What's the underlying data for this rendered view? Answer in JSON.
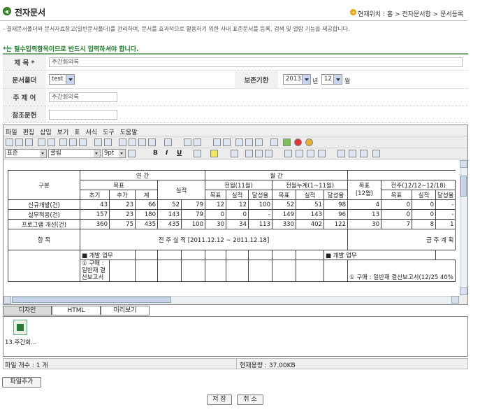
{
  "header": {
    "title": "전자문서",
    "location": "현재위치 : 홈 > 전자문서함 > 문서등록"
  },
  "description": "- 결재문서폴더와 문서자료창고(일반문서폴더)를 관리하며, 문서를 효과적으로 활용하기 위한 사내 표준문서를 등록, 검색 및 열람 기능을 제공합니다.",
  "required_note": "*는 필수입력항목이므로 반드시 입력하셔야 합니다.",
  "form": {
    "title_label": "제 목 *",
    "title_value": "주간회의록",
    "folder_label": "문서폴더",
    "folder_value": "test",
    "retention_label": "보존기한",
    "year_value": "2013",
    "year_unit": "년",
    "month_value": "12",
    "month_unit": "월",
    "subject_label": "주 제 어",
    "subject_value": "주간회의록",
    "ref_label": "참조문헌",
    "ref_value": ""
  },
  "editor": {
    "menu": [
      "파일",
      "편집",
      "삽입",
      "보기",
      "표",
      "서식",
      "도구",
      "도움말"
    ],
    "style_value": "표준",
    "font_value": "굴림",
    "size_value": "9pt",
    "tabs": [
      "디자인",
      "HTML",
      "미리보기"
    ],
    "table": {
      "h_gubun": "구분",
      "h_yearly": "연 간",
      "h_monthly": "월 간",
      "h_target": "목표",
      "h_actual": "실적",
      "h_initial": "초기",
      "h_added": "추가",
      "h_total": "계",
      "h_rate": "달성율",
      "h_prev_month": "전월(11월)",
      "h_cumulative": "전월누계(1~11월)",
      "h_target12": "목표\n(12월)",
      "h_prev_week": "전주(12/12~12/18)",
      "rows": [
        {
          "name": "신규개발(건)",
          "v": [
            "43",
            "23",
            "66",
            "52",
            "79",
            "12",
            "12",
            "100",
            "52",
            "51",
            "98",
            "4",
            "0",
            "0",
            "-"
          ]
        },
        {
          "name": "실무적용(건)",
          "v": [
            "157",
            "23",
            "180",
            "143",
            "79",
            "0",
            "0",
            "-",
            "149",
            "143",
            "96",
            "13",
            "0",
            "0",
            "-"
          ]
        },
        {
          "name": "프로그램 개선(건)",
          "v": [
            "360",
            "75",
            "435",
            "435",
            "100",
            "30",
            "34",
            "113",
            "330",
            "402",
            "122",
            "30",
            "7",
            "8",
            "1"
          ]
        }
      ],
      "h_item": "항 목",
      "h_last_week": "전 주 실 적 [2011.12.12 ~ 2011.12.18]",
      "h_this_week": "금 주 계 획",
      "dev_work": "■ 개발 업무",
      "dev_work2": "■ 개발 업무",
      "purchase": "① 구매 : 일반재 결 산보고서",
      "purchase2": "① 구매 : 일반재 결산보고서(12/25 40%"
    }
  },
  "files": {
    "name": "13.주간회...",
    "count_text": "파일 개수 : 1 개",
    "size_text": "현재용량 : 37.00KB"
  },
  "buttons": {
    "add_file": "파일추가",
    "save": "저 장",
    "cancel": "취 소"
  }
}
